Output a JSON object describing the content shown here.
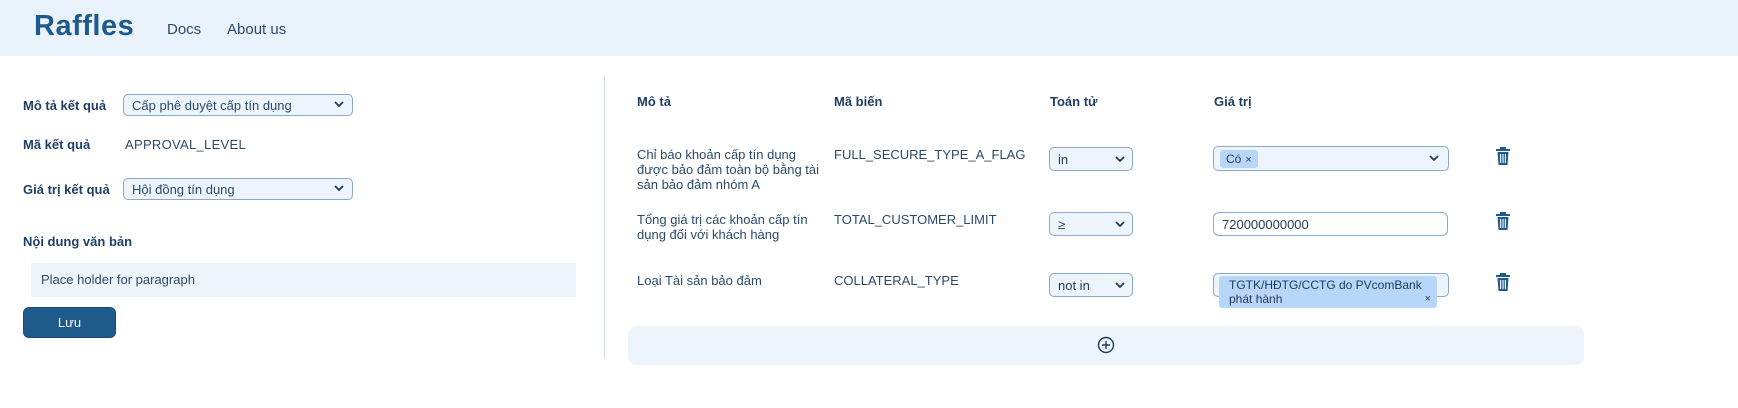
{
  "brand": "Raffles",
  "nav": {
    "docs": "Docs",
    "about": "About us"
  },
  "left": {
    "result_desc_label": "Mô tả kết quả",
    "result_desc_value": "Cấp phê duyệt cấp tín dụng",
    "result_code_label": "Mã kết quả",
    "result_code_value": "APPROVAL_LEVEL",
    "result_value_label": "Giá trị kết quả",
    "result_value_value": "Hội đồng tín dụng",
    "content_label": "Nội dung văn bản",
    "paragraph": "Place holder for paragraph",
    "save_label": "Lưu"
  },
  "table": {
    "headers": {
      "desc": "Mô tả",
      "var": "Mã biến",
      "op": "Toán tử",
      "val": "Giá trị"
    },
    "rows": [
      {
        "desc": "Chỉ báo khoản cấp tín dụng được bảo đảm toàn bộ bằng tài sản bảo đảm nhóm A",
        "var": "FULL_SECURE_TYPE_A_FLAG",
        "op": "in",
        "chip": "Có"
      },
      {
        "desc": "Tổng giá trị các khoản cấp tín dụng đối với khách hàng",
        "var": "TOTAL_CUSTOMER_LIMIT",
        "op": "≥",
        "input": "720000000000"
      },
      {
        "desc": "Loại Tài sản bảo đảm",
        "var": "COLLATERAL_TYPE",
        "op": "not in",
        "chip": "TGTK/HĐTG/CCTG do PVcomBank phát hành"
      }
    ],
    "chip_remove": "×"
  },
  "icons": [
    "chevron-down-icon",
    "trash-icon",
    "plus-circle-icon"
  ],
  "colors": {
    "brand": "#1f5a8c",
    "navbar_bg": "#eaf2fb",
    "field_bg": "#edf4fc",
    "chip_bg": "#b8d6f7"
  }
}
